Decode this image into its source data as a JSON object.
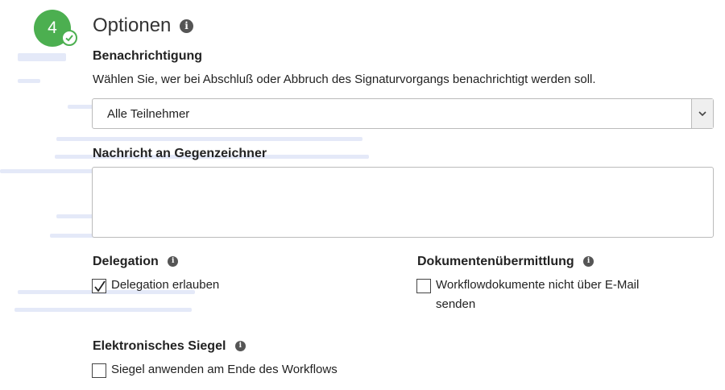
{
  "step": {
    "number": "4"
  },
  "section": {
    "title": "Optionen"
  },
  "notification": {
    "label": "Benachrichtigung",
    "description": "Wählen Sie, wer bei Abschluß oder Abbruch des Signaturvorgangs benachrichtigt werden soll.",
    "select_value": "Alle Teilnehmer"
  },
  "message": {
    "label": "Nachricht an Gegenzeichner",
    "value": ""
  },
  "delegation": {
    "label": "Delegation",
    "checkbox_label": "Delegation erlauben",
    "checked": true
  },
  "document_delivery": {
    "label": "Dokumentenübermittlung",
    "checkbox_label_line1": "Workflowdokumente nicht über E-Mail",
    "checkbox_label_line2": "senden",
    "checked": false
  },
  "seal": {
    "label": "Elektronisches Siegel",
    "checkbox_label": "Siegel anwenden am Ende des Workflows",
    "checked": false
  },
  "colors": {
    "accent_green": "#4caf50",
    "info_icon": "#555555"
  }
}
